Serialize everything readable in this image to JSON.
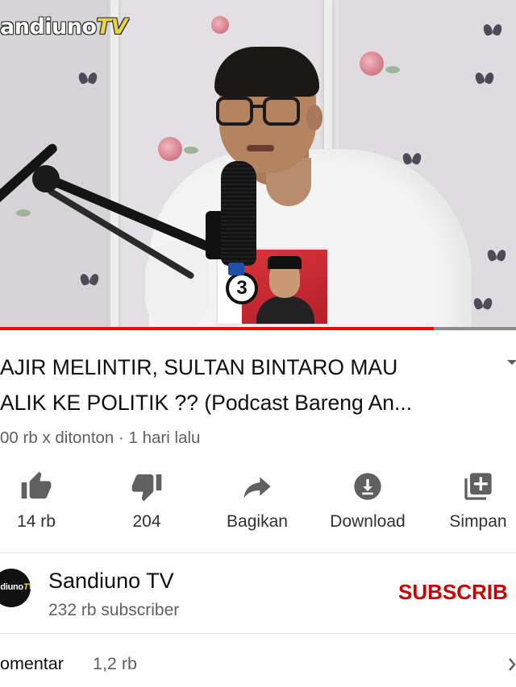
{
  "video": {
    "watermark_main": "andiuno",
    "watermark_tv": "TV",
    "sticker_number": "3",
    "progress_fraction": 0.84
  },
  "details": {
    "title_line1": "AJIR MELINTIR, SULTAN BINTARO MAU",
    "title_line2": "ALIK KE POLITIK ?? (Podcast Bareng An...",
    "meta": "00 rb x ditonton · 1 hari lalu"
  },
  "actions": [
    {
      "label": "14 rb",
      "icon": "thumbs-up-icon"
    },
    {
      "label": "204",
      "icon": "thumbs-down-icon"
    },
    {
      "label": "Bagikan",
      "icon": "share-icon"
    },
    {
      "label": "Download",
      "icon": "download-icon"
    },
    {
      "label": "Simpan",
      "icon": "save-playlist-icon"
    }
  ],
  "channel": {
    "avatar_text_main": "ndiuno",
    "avatar_text_tv": "TV",
    "name": "Sandiuno TV",
    "subscribers": "232 rb subscriber",
    "subscribe_label": "SUBSCRIB"
  },
  "comments": {
    "label": "omentar",
    "count": "1,2 rb"
  },
  "colors": {
    "accent_red": "#ff0000",
    "subscribe_red": "#cc0000",
    "icon_gray": "#606060",
    "text_primary": "#0f0f0f",
    "text_secondary": "#606060"
  }
}
